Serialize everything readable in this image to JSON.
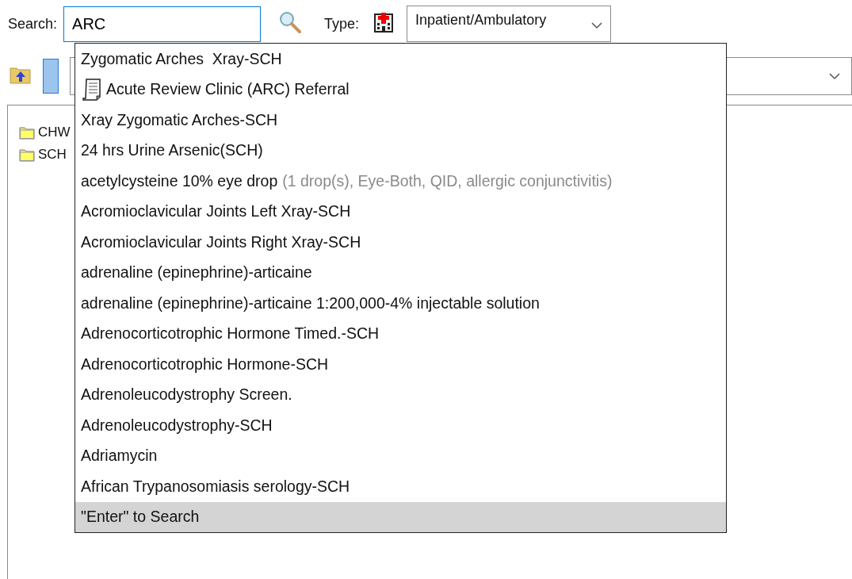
{
  "search": {
    "label": "Search:",
    "value": "ARC"
  },
  "type": {
    "label": "Type:",
    "value": "Inpatient/Ambulatory"
  },
  "tree": [
    {
      "label": "CHW"
    },
    {
      "label": "SCH"
    }
  ],
  "suggestions": [
    {
      "kind": "plain",
      "text": "Zygomatic Arches  Xray-SCH"
    },
    {
      "kind": "document",
      "text": "Acute Review Clinic (ARC) Referral"
    },
    {
      "kind": "plain",
      "text": "Xray Zygomatic Arches-SCH"
    },
    {
      "kind": "plain",
      "text": "24 hrs Urine Arsenic(SCH)"
    },
    {
      "kind": "plain",
      "text": "acetylcysteine 10% eye drop",
      "detail": "(1 drop(s), Eye-Both, QID, allergic conjunctivitis)"
    },
    {
      "kind": "plain",
      "text": "Acromioclavicular Joints Left Xray-SCH"
    },
    {
      "kind": "plain",
      "text": "Acromioclavicular Joints Right Xray-SCH"
    },
    {
      "kind": "plain",
      "text": "adrenaline (epinephrine)-articaine"
    },
    {
      "kind": "plain",
      "text": "adrenaline (epinephrine)-articaine 1:200,000-4% injectable solution"
    },
    {
      "kind": "plain",
      "text": "Adrenocorticotrophic Hormone Timed.-SCH"
    },
    {
      "kind": "plain",
      "text": "Adrenocorticotrophic Hormone-SCH"
    },
    {
      "kind": "plain",
      "text": "Adrenoleucodystrophy Screen."
    },
    {
      "kind": "plain",
      "text": "Adrenoleucodystrophy-SCH"
    },
    {
      "kind": "plain",
      "text": "Adriamycin"
    },
    {
      "kind": "plain",
      "text": "African Trypanosomiasis serology-SCH"
    }
  ],
  "footer": "\"Enter\" to Search"
}
